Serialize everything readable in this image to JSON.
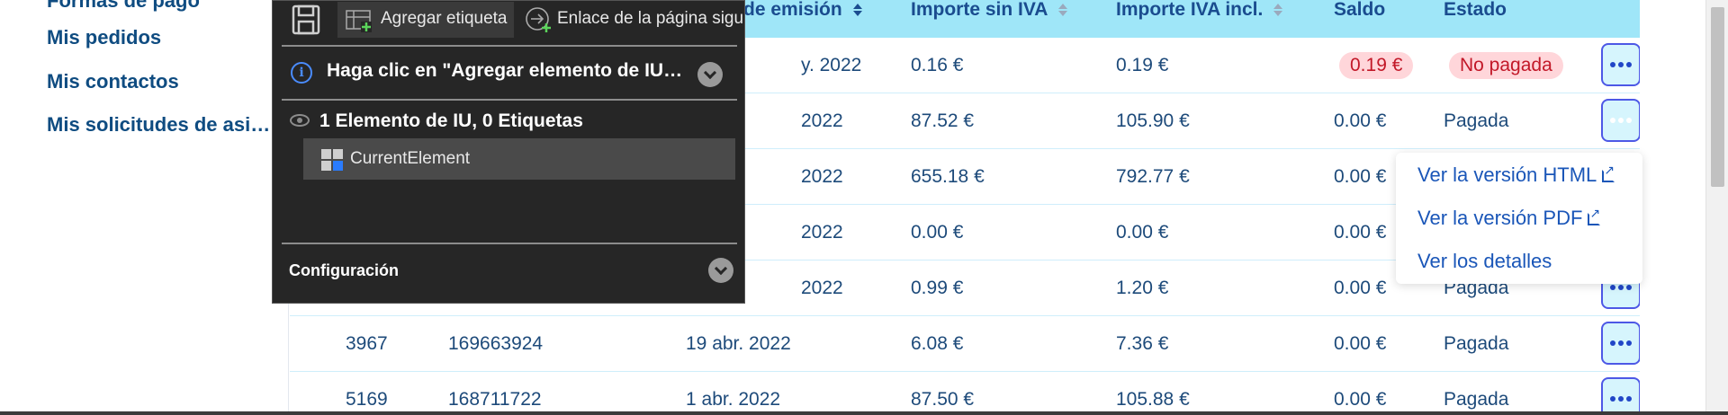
{
  "sidebar": {
    "items": [
      {
        "label": "Formas de pago"
      },
      {
        "label": "Mis pedidos"
      },
      {
        "label": "Mis contactos"
      },
      {
        "label": "Mis solicitudes de asistencia"
      }
    ]
  },
  "table": {
    "headers": [
      "de emisión",
      "Importe sin IVA",
      "Importe IVA incl.",
      "Saldo",
      "Estado"
    ],
    "rows": [
      {
        "ref": "",
        "order": "",
        "date": "y. 2022",
        "net": "0.16 €",
        "gross": "0.19 €",
        "balance": "0.19 €",
        "status": "No pagada"
      },
      {
        "ref": "",
        "order": "",
        "date": "2022",
        "net": "87.52 €",
        "gross": "105.90 €",
        "balance": "0.00 €",
        "status": "Pagada"
      },
      {
        "ref": "",
        "order": "",
        "date": "2022",
        "net": "655.18 €",
        "gross": "792.77 €",
        "balance": "0.00 €",
        "status": ""
      },
      {
        "ref": "",
        "order": "",
        "date": "2022",
        "net": "0.00 €",
        "gross": "0.00 €",
        "balance": "0.00 €",
        "status": ""
      },
      {
        "ref": "",
        "order": "",
        "date": "2022",
        "net": "0.99 €",
        "gross": "1.20 €",
        "balance": "0.00 €",
        "status": "Pagada"
      },
      {
        "ref": "3967",
        "order": "169663924",
        "date": "19 abr. 2022",
        "net": "6.08 €",
        "gross": "7.36 €",
        "balance": "0.00 €",
        "status": "Pagada"
      },
      {
        "ref": "5169",
        "order": "168711722",
        "date": "1 abr. 2022",
        "net": "87.50 €",
        "gross": "105.88 €",
        "balance": "0.00 €",
        "status": "Pagada"
      }
    ]
  },
  "dropdown": {
    "items": [
      "Ver la versión HTML",
      "Ver la versión PDF",
      "Ver los detalles"
    ]
  },
  "recorder": {
    "add_label": "Agregar etiqueta",
    "next_link": "Enlace de la página siguiente",
    "info": "Haga clic en \"Agregar elemento de IU\" para agregar",
    "summary": "1 Elemento de IU, 0 Etiquetas",
    "element": "CurrentElement",
    "config": "Configuración"
  },
  "colors": {
    "header_bg": "#9fe6f8",
    "link": "#0f4c81",
    "unpaid_bg": "#ffd6da",
    "unpaid_text": "#c21828",
    "panel_bg": "#262626"
  }
}
